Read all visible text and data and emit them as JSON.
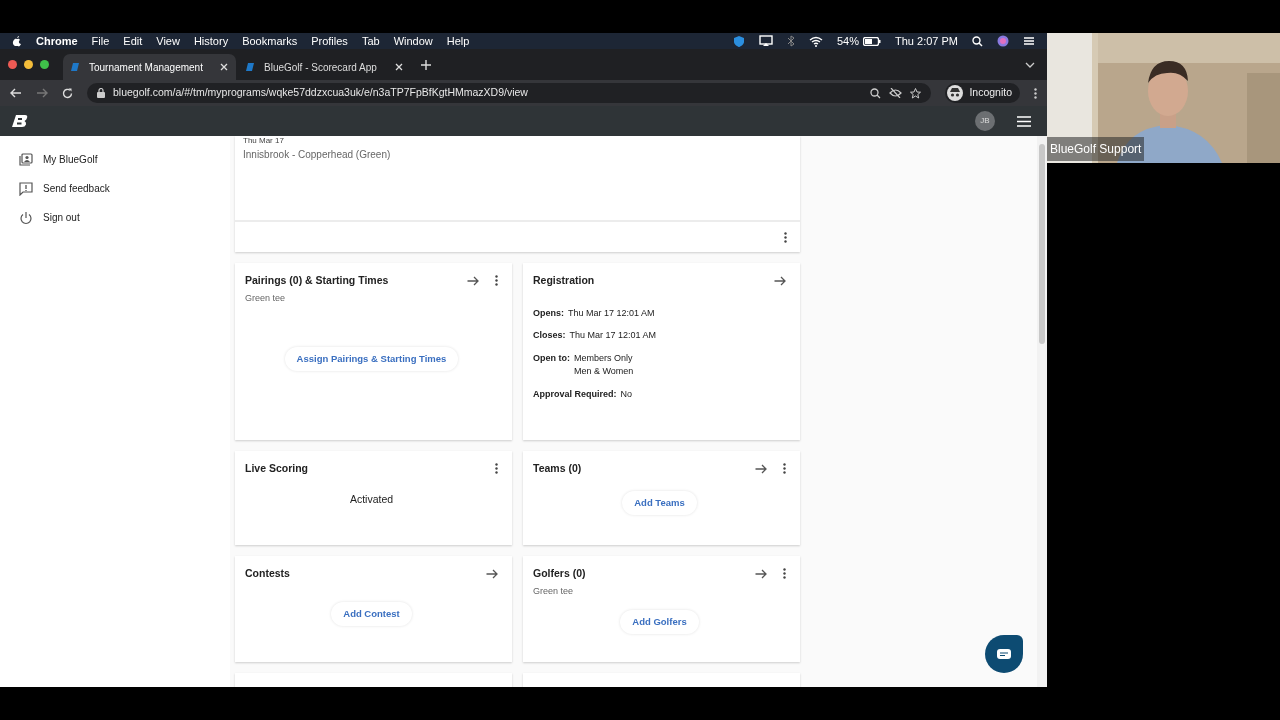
{
  "menubar": {
    "app": "Chrome",
    "menus": [
      "File",
      "Edit",
      "View",
      "History",
      "Bookmarks",
      "Profiles",
      "Tab",
      "Window",
      "Help"
    ],
    "battery": "54%",
    "clock": "Thu 2:07 PM"
  },
  "tabs": [
    {
      "title": "Tournament Management",
      "selected": true
    },
    {
      "title": "BlueGolf - Scorecard App",
      "selected": false
    }
  ],
  "address_bar": {
    "url": "bluegolf.com/a/#/tm/myprograms/wqke57ddzxcua3uk/e/n3aTP7FpBfKgtHMmazXD9/view",
    "profile": "Incognito"
  },
  "app_header": {
    "avatar": "JB"
  },
  "sidebar": {
    "items": [
      {
        "label": "My BlueGolf"
      },
      {
        "label": "Send feedback"
      },
      {
        "label": "Sign out"
      }
    ]
  },
  "event_card": {
    "date": "Thu Mar 17",
    "course": "Innisbrook - Copperhead (Green)"
  },
  "cards": [
    {
      "kind": "action",
      "title": "Pairings (0) & Starting Times",
      "subtitle": "Green tee",
      "arrow": true,
      "menu": true,
      "action": "Assign Pairings & Starting Times"
    },
    {
      "kind": "details",
      "title": "Registration",
      "arrow": true,
      "menu": false,
      "fields": [
        {
          "label": "Opens:",
          "values": [
            "Thu Mar 17 12:01 AM"
          ]
        },
        {
          "label": "Closes:",
          "values": [
            "Thu Mar 17 12:01 AM"
          ]
        },
        {
          "label": "Open to:",
          "values": [
            "Members Only",
            "Men & Women"
          ]
        },
        {
          "label": "Approval Required:",
          "values": [
            "No"
          ]
        }
      ]
    },
    {
      "kind": "status",
      "title": "Live Scoring",
      "arrow": false,
      "menu": true,
      "status": "Activated"
    },
    {
      "kind": "action",
      "title": "Teams (0)",
      "arrow": true,
      "menu": true,
      "action": "Add Teams"
    },
    {
      "kind": "action",
      "title": "Contests",
      "arrow": true,
      "menu": false,
      "action": "Add Contest"
    },
    {
      "kind": "action",
      "title": "Golfers (0)",
      "subtitle": "Green tee",
      "arrow": true,
      "menu": true,
      "action": "Add Golfers"
    }
  ],
  "webcam": {
    "caption": "BlueGolf Support"
  }
}
